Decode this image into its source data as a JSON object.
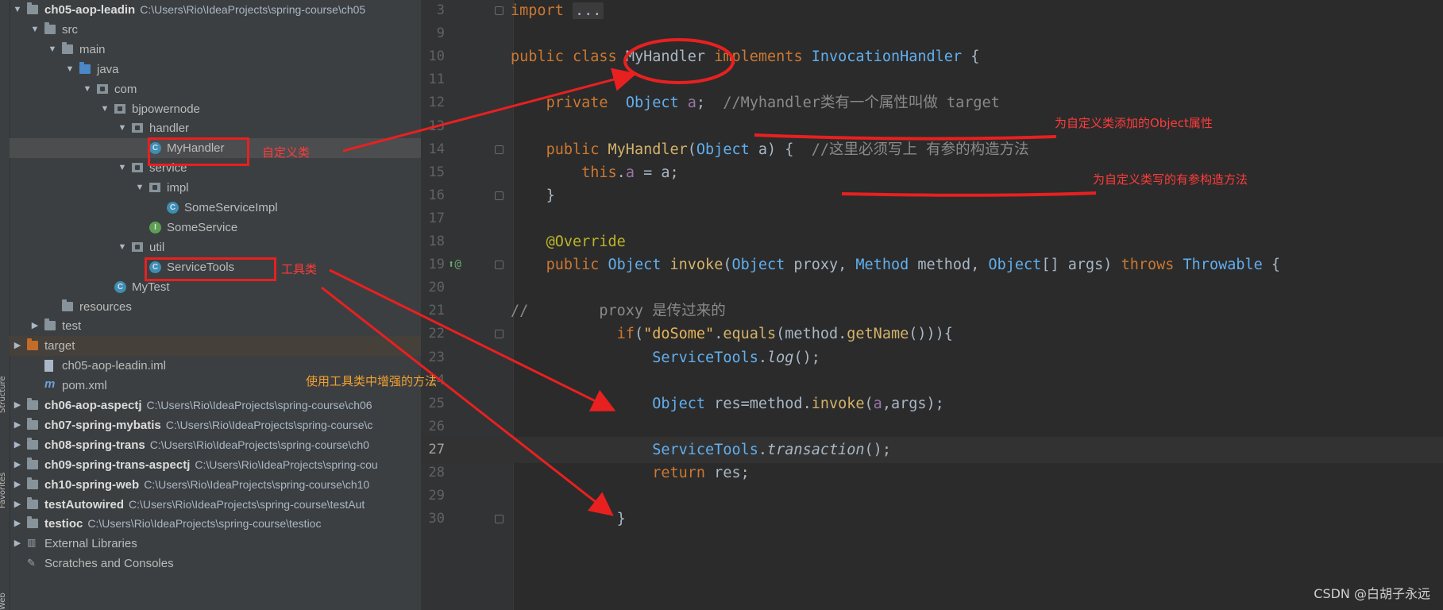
{
  "project_tree": {
    "rows": [
      {
        "label": "ch05-aop-leadin",
        "bold": true,
        "path": "C:\\Users\\Rio\\IdeaProjects\\spring-course\\ch05",
        "arrow": "▼",
        "icon": "folder"
      },
      {
        "label": "src",
        "arrow": "▼",
        "icon": "folder"
      },
      {
        "label": "main",
        "arrow": "▼",
        "icon": "folder"
      },
      {
        "label": "java",
        "arrow": "▼",
        "icon": "folder-blue"
      },
      {
        "label": "com",
        "arrow": "▼",
        "icon": "package"
      },
      {
        "label": "bjpowernode",
        "arrow": "▼",
        "icon": "package"
      },
      {
        "label": "handler",
        "arrow": "▼",
        "icon": "package"
      },
      {
        "label": "MyHandler",
        "arrow": "",
        "icon": "class",
        "selected": true
      },
      {
        "label": "service",
        "arrow": "▼",
        "icon": "package"
      },
      {
        "label": "impl",
        "arrow": "▼",
        "icon": "package"
      },
      {
        "label": "SomeServiceImpl",
        "arrow": "",
        "icon": "class"
      },
      {
        "label": "SomeService",
        "arrow": "",
        "icon": "interface"
      },
      {
        "label": "util",
        "arrow": "▼",
        "icon": "package"
      },
      {
        "label": "ServiceTools",
        "arrow": "",
        "icon": "class"
      },
      {
        "label": "MyTest",
        "arrow": "",
        "icon": "class"
      },
      {
        "label": "resources",
        "arrow": "",
        "icon": "folder"
      },
      {
        "label": "test",
        "arrow": "▶",
        "icon": "folder"
      },
      {
        "label": "target",
        "arrow": "▶",
        "icon": "folder-orange",
        "dim": true
      },
      {
        "label": "ch05-aop-leadin.iml",
        "arrow": "",
        "icon": "file"
      },
      {
        "label": "pom.xml",
        "arrow": "",
        "icon": "maven"
      },
      {
        "label": "ch06-aop-aspectj",
        "bold": true,
        "path": "C:\\Users\\Rio\\IdeaProjects\\spring-course\\ch06",
        "arrow": "▶",
        "icon": "folder"
      },
      {
        "label": "ch07-spring-mybatis",
        "bold": true,
        "path": "C:\\Users\\Rio\\IdeaProjects\\spring-course\\c",
        "arrow": "▶",
        "icon": "folder"
      },
      {
        "label": "ch08-spring-trans",
        "bold": true,
        "path": "C:\\Users\\Rio\\IdeaProjects\\spring-course\\ch0",
        "arrow": "▶",
        "icon": "folder"
      },
      {
        "label": "ch09-spring-trans-aspectj",
        "bold": true,
        "path": "C:\\Users\\Rio\\IdeaProjects\\spring-cou",
        "arrow": "▶",
        "icon": "folder"
      },
      {
        "label": "ch10-spring-web",
        "bold": true,
        "path": "C:\\Users\\Rio\\IdeaProjects\\spring-course\\ch10",
        "arrow": "▶",
        "icon": "folder"
      },
      {
        "label": "testAutowired",
        "bold": true,
        "path": "C:\\Users\\Rio\\IdeaProjects\\spring-course\\testAut",
        "arrow": "▶",
        "icon": "folder"
      },
      {
        "label": "testioc",
        "bold": true,
        "path": "C:\\Users\\Rio\\IdeaProjects\\spring-course\\testioc",
        "arrow": "▶",
        "icon": "folder"
      },
      {
        "label": "External Libraries",
        "arrow": "▶",
        "icon": "library"
      },
      {
        "label": "Scratches and Consoles",
        "arrow": "",
        "icon": "scratch"
      }
    ]
  },
  "side_strip": {
    "labels": [
      "Structure",
      "Favorites",
      "Web"
    ]
  },
  "editor": {
    "lines": [
      {
        "n": "3"
      },
      {
        "n": "9"
      },
      {
        "n": "10"
      },
      {
        "n": "11"
      },
      {
        "n": "12"
      },
      {
        "n": "13"
      },
      {
        "n": "14"
      },
      {
        "n": "15"
      },
      {
        "n": "16"
      },
      {
        "n": "17"
      },
      {
        "n": "18"
      },
      {
        "n": "19"
      },
      {
        "n": "20"
      },
      {
        "n": "21"
      },
      {
        "n": "22"
      },
      {
        "n": "23"
      },
      {
        "n": "24"
      },
      {
        "n": "25"
      },
      {
        "n": "26"
      },
      {
        "n": "27"
      },
      {
        "n": "28"
      },
      {
        "n": "29"
      },
      {
        "n": "30"
      }
    ],
    "code": {
      "l3_import": "import",
      "l3_dots": "...",
      "l10_public": "public",
      "l10_class": "class",
      "l10_name": "MyHandler",
      "l10_implements": "implements",
      "l10_iface": "InvocationHandler",
      "l10_brace": "{",
      "l12_private": "private",
      "l12_type": "Object",
      "l12_field": "a",
      "l12_semi": ";",
      "l12_comment": "//Myhandler类有一个属性叫做 target",
      "l14_public": "public",
      "l14_ctor": "MyHandler",
      "l14_paren": "(",
      "l14_type": "Object",
      "l14_param": " a) {",
      "l14_comment": "//这里必须写上 有参的构造方法",
      "l15_this": "this",
      "l15_dot": ".",
      "l15_field": "a",
      "l15_rest": " = a;",
      "l16_brace": "}",
      "l18_ann": "@Override",
      "l19_public": "public",
      "l19_ret": "Object",
      "l19_name": "invoke",
      "l19_p1t": "Object",
      "l19_p1": " proxy, ",
      "l19_p2t": "Method",
      "l19_p2": " method, ",
      "l19_p3t": "Object",
      "l19_p3": "[] args) ",
      "l19_throws": "throws",
      "l19_ex": "Throwable",
      "l19_brace": " {",
      "l21_comment": "//        proxy 是传过来的",
      "l22_if": "if",
      "l22_open": "(",
      "l22_str": "\"doSome\"",
      "l22_dot": ".",
      "l22_equals": "equals",
      "l22_mid": "(method.",
      "l22_getName": "getName",
      "l22_end": "())){",
      "l23_cls": "ServiceTools",
      "l23_dot": ".",
      "l23_log": "log",
      "l23_end": "();",
      "l25_type": "Object",
      "l25_mid": " res=method.",
      "l25_invoke": "invoke",
      "l25_open": "(",
      "l25_a": "a",
      "l25_end": ",args);",
      "l27_cls": "ServiceTools",
      "l27_dot": ".",
      "l27_tx": "transaction",
      "l27_end": "();",
      "l28_return": "return",
      "l28_rest": " res;",
      "l30_brace": "}"
    }
  },
  "annotations": {
    "custom_class": "自定义类",
    "tool_class": "工具类",
    "use_tool_methods": "使用工具类中增强的方法",
    "object_attr": "为自定义类添加的Object属性",
    "ctor_note": "为自定义类写的有参构造方法"
  },
  "watermark": "CSDN @白胡子永远",
  "colors": {
    "annotation": "#ff3b3b",
    "annotation_orange": "#f0a030",
    "keyword": "#cc7832",
    "class_ref": "#61afef"
  }
}
